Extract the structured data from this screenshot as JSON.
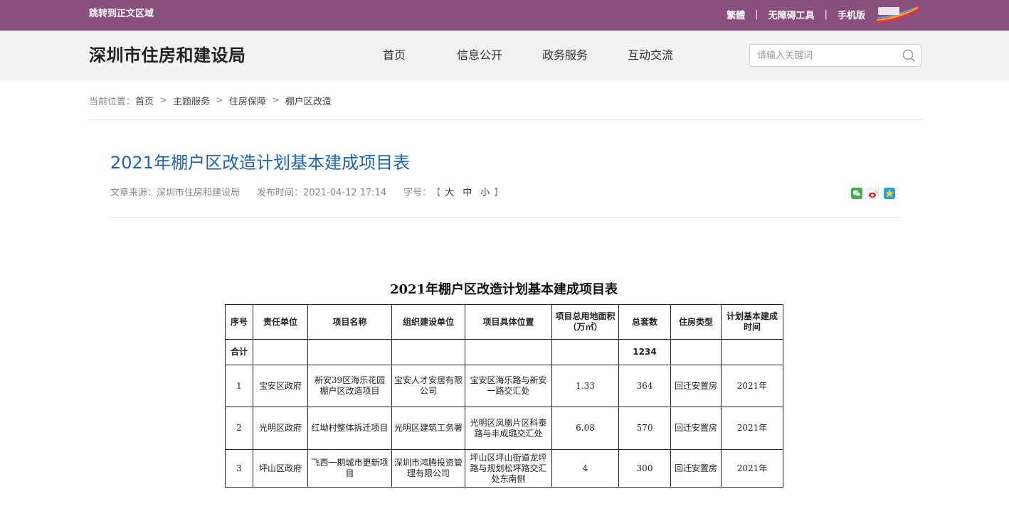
{
  "topbar": {
    "skip_link": "跳转到正文区域",
    "links": [
      "繁體",
      "无障碍工具",
      "手机版"
    ]
  },
  "header": {
    "site_name": "深圳市住房和建设局",
    "nav": [
      "首页",
      "信息公开",
      "政务服务",
      "互动交流"
    ],
    "search_placeholder": "请输入关键词"
  },
  "breadcrumb": {
    "prefix": "当前位置：",
    "items": [
      "首页",
      "主题服务",
      "住房保障",
      "棚户区改造"
    ]
  },
  "article": {
    "title": "2021年棚户区改造计划基本建成项目表",
    "source": "文章来源：深圳市住房和建设局",
    "published": "发布时间：2021-04-12 17:14",
    "font_label": "字号：",
    "font_open": "【",
    "font_sizes": [
      "大",
      "中",
      "小"
    ],
    "font_close": "】",
    "share_icons": [
      "wechat-icon",
      "weibo-icon",
      "qzone-icon"
    ]
  },
  "table": {
    "title": "2021年棚户区改造计划基本建成项目表",
    "headers": [
      "序号",
      "责任单位",
      "项目名称",
      "组织建设单位",
      "项目具体位置",
      "项目总用地面积（万㎡）",
      "总套数",
      "住房类型",
      "计划基本建成时间"
    ],
    "total_row": {
      "label": "合计",
      "total_units": "1234"
    },
    "rows": [
      {
        "no": "1",
        "dept": "宝安区政府",
        "name": "新安39区海乐花园棚户区改造项目",
        "builder": "宝安人才安居有限公司",
        "location": "宝安区海乐路与新安一路交汇处",
        "area": "1.33",
        "units": "364",
        "type": "回迁安置房",
        "year": "2021年"
      },
      {
        "no": "2",
        "dept": "光明区政府",
        "name": "红坳村整体拆迁项目",
        "builder": "光明区建筑工务署",
        "location": "光明区凤凰片区科泰路与丰成璐交汇处",
        "area": "6.08",
        "units": "570",
        "type": "回迁安置房",
        "year": "2021年"
      },
      {
        "no": "3",
        "dept": "坪山区政府",
        "name": "飞西一期城市更新项目",
        "builder": "深圳市鸿腾投资管理有限公司",
        "location": "坪山区坪山街道龙坪路与规划松坪路交汇处东南侧",
        "area": "4",
        "units": "300",
        "type": "回迁安置房",
        "year": "2021年"
      }
    ]
  },
  "colors": {
    "topbar": "#8a4f7d",
    "header_bg": "#f2f2f2",
    "title_blue": "#1c62b9"
  }
}
